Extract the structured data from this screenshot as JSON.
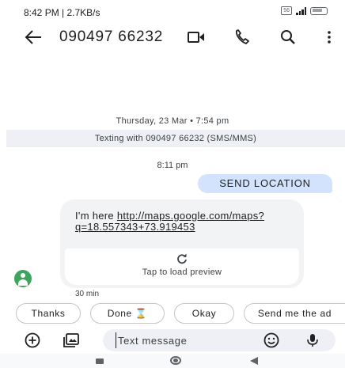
{
  "status_bar": {
    "time_speed": "8:42 PM | 2.7KB/s",
    "sim_label": "56"
  },
  "header": {
    "title": "090497 66232"
  },
  "thread": {
    "date": "Thursday, 23 Mar • 7:54 pm",
    "banner": "Texting with 090497 66232 (SMS/MMS)",
    "sent_time": "8:11 pm",
    "sent_message": "SEND LOCATION",
    "received": {
      "prefix": "I'm here ",
      "link": "http://maps.google.com/maps?q=18.557343+73.919453",
      "preview_label": "Tap to load preview",
      "time": "30 min"
    }
  },
  "suggestions": [
    "Thanks",
    "Done ⌛",
    "Okay",
    "Send me the ad"
  ],
  "compose": {
    "placeholder": "Text message"
  },
  "colors": {
    "sent_bubble": "#d3e3fd",
    "received_bubble": "#f1f3f4",
    "avatar": "#3ea55e",
    "banner": "#eef0f5"
  },
  "icons": {
    "back": "back-arrow-icon",
    "video": "video-call-icon",
    "phone": "phone-icon",
    "search": "search-icon",
    "menu": "more-vert-icon",
    "refresh": "refresh-icon",
    "add": "add-circle-icon",
    "media": "media-gallery-icon",
    "emoji": "emoji-icon",
    "mic": "mic-icon"
  }
}
